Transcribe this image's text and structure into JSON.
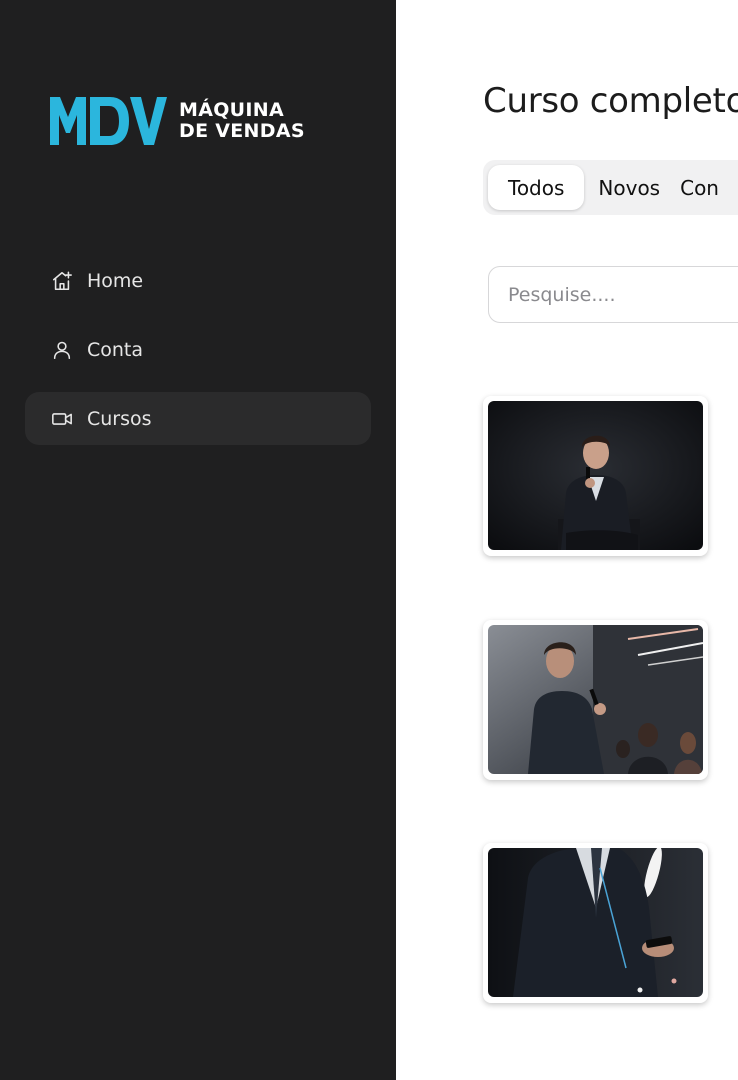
{
  "brand": {
    "mark": "MDV",
    "name_line1": "MÁQUINA",
    "name_line2": "DE VENDAS",
    "accent_color": "#2bb6dd"
  },
  "sidebar": {
    "items": [
      {
        "label": "Home",
        "icon": "home-icon",
        "active": false
      },
      {
        "label": "Conta",
        "icon": "user-icon",
        "active": false
      },
      {
        "label": "Cursos",
        "icon": "video-camera-icon",
        "active": true
      }
    ]
  },
  "main": {
    "title": "Curso completo",
    "tabs": [
      {
        "label": "Todos",
        "active": true
      },
      {
        "label": "Novos",
        "active": false
      },
      {
        "label": "Con",
        "active": false
      }
    ],
    "search": {
      "placeholder": "Pesquise...."
    },
    "courses": [
      {
        "thumbnail": "speaker-seated-with-microphone-photo"
      },
      {
        "thumbnail": "speaker-standing-addressing-audience-photo"
      },
      {
        "thumbnail": "man-in-suit-looking-at-phone-photo"
      }
    ]
  },
  "colors": {
    "sidebar_bg": "#1f1f20",
    "sidebar_active_bg": "#2b2b2c",
    "tabs_bg": "#f1f1f2"
  }
}
